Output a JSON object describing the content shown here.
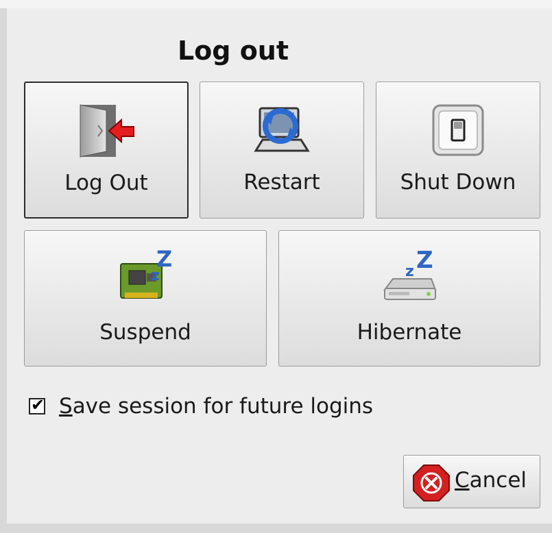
{
  "dialog": {
    "title": "Log out"
  },
  "actions": [
    {
      "id": "logout",
      "label": "Log Out",
      "icon": "logout-door-icon"
    },
    {
      "id": "restart",
      "label": "Restart",
      "icon": "restart-icon"
    },
    {
      "id": "shutdown",
      "label": "Shut Down",
      "icon": "power-switch-icon"
    },
    {
      "id": "suspend",
      "label": "Suspend",
      "icon": "suspend-chip-icon"
    },
    {
      "id": "hibernate",
      "label": "Hibernate",
      "icon": "hibernate-disk-icon"
    }
  ],
  "save_session": {
    "checked": true,
    "mnemonic": "S",
    "label_rest": "ave session for future logins"
  },
  "cancel": {
    "mnemonic": "C",
    "label_rest": "ancel",
    "icon": "cancel-icon"
  },
  "colors": {
    "dialog_bg": "#ededed",
    "cancel_red": "#d42020",
    "logout_arrow_red": "#e41e1e",
    "zz_blue": "#2f66c2"
  }
}
